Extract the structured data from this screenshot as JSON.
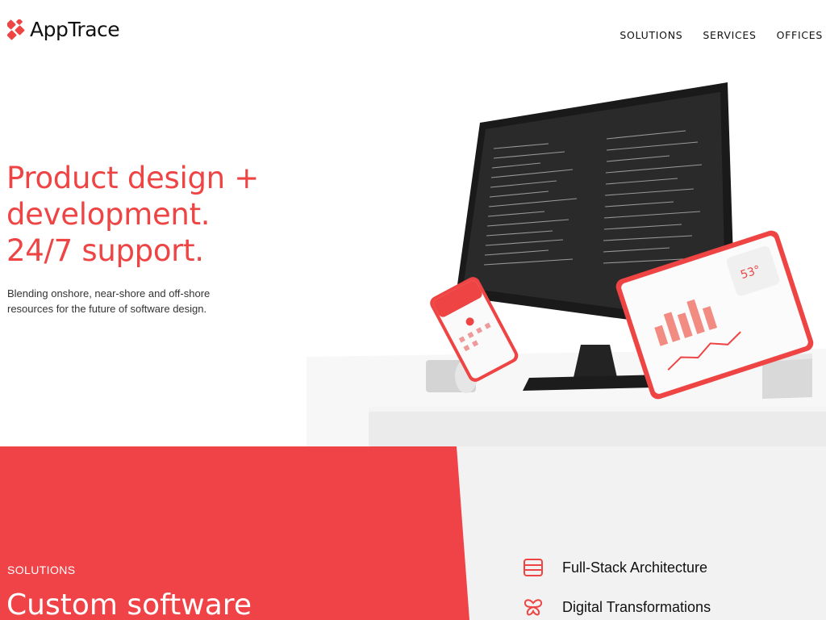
{
  "brand": {
    "name": "AppTrace",
    "accent": "#ef4444"
  },
  "nav": {
    "items": [
      "SOLUTIONS",
      "SERVICES",
      "OFFICES"
    ]
  },
  "hero": {
    "title_lines": [
      "Product design +",
      "development.",
      "24/7 support."
    ],
    "subtitle_lines": [
      "Blending onshore, near-shore and off-shore",
      "resources for the future of software design."
    ],
    "image_alt": "Desktop monitor with code editor, phone and tablet showing dashboards"
  },
  "solutions": {
    "label": "SOLUTIONS",
    "title": "Custom software",
    "items": [
      {
        "label": "Full-Stack Architecture",
        "icon": "layers-icon"
      },
      {
        "label": "Digital Transformations",
        "icon": "butterfly-icon"
      }
    ]
  }
}
